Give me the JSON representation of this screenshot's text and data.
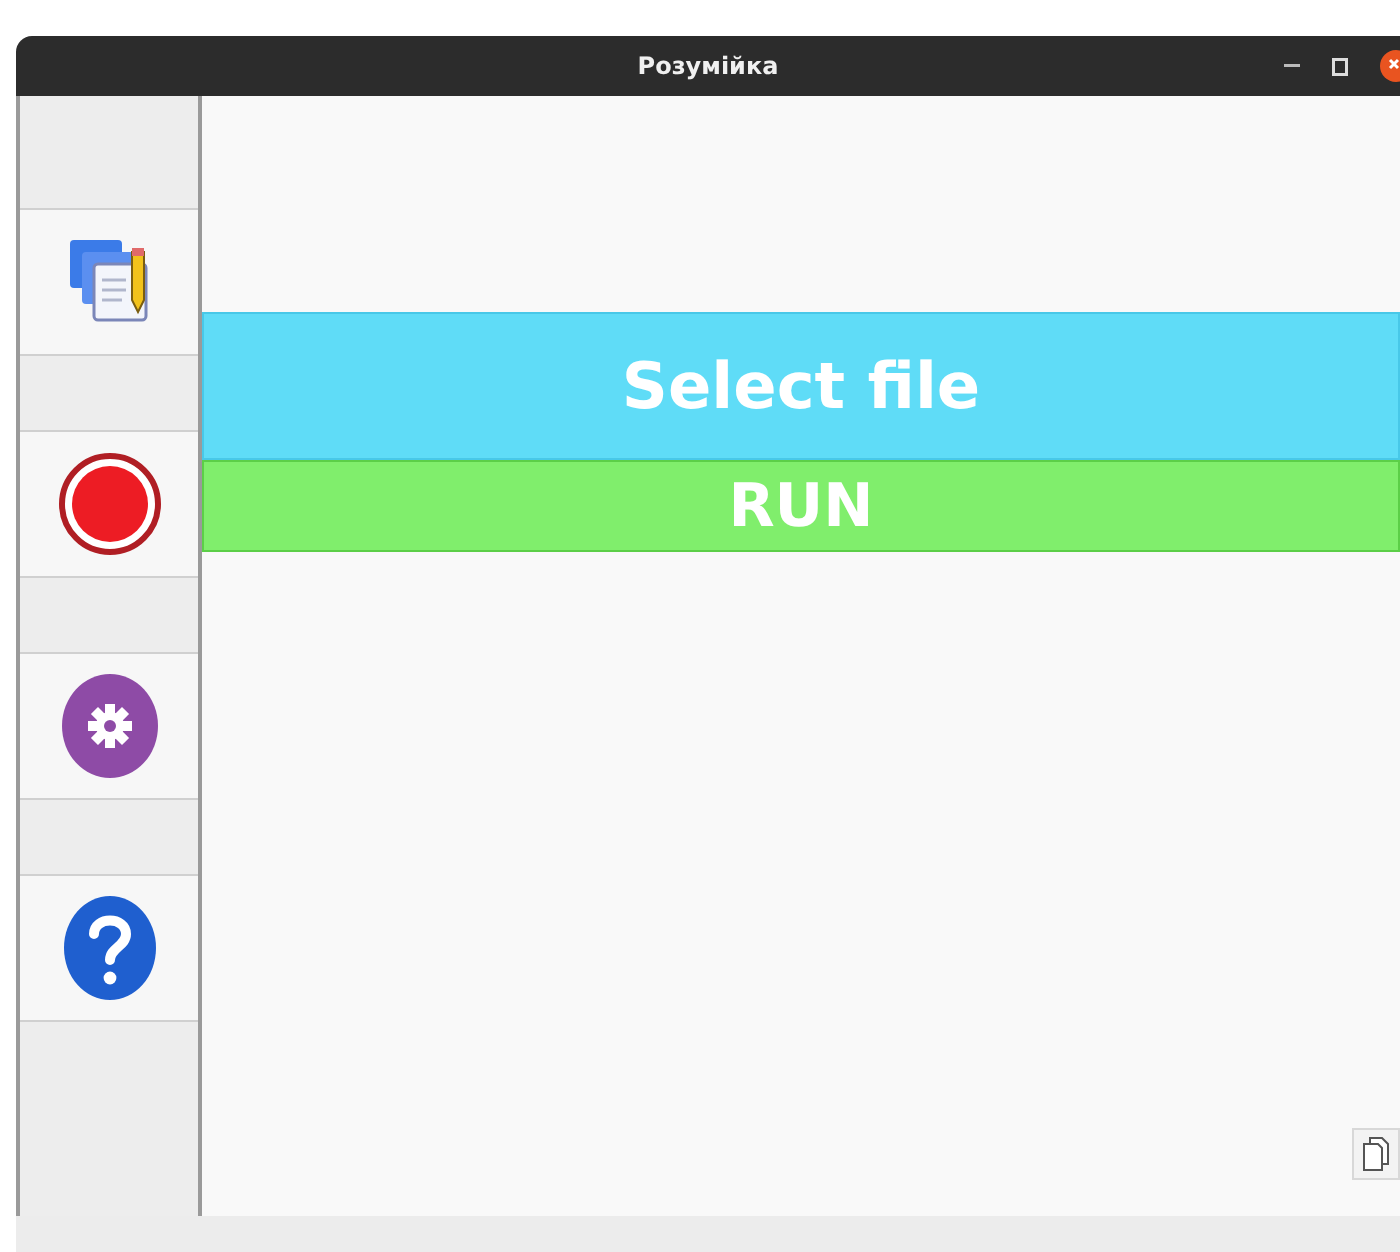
{
  "window": {
    "title": "Розумійка"
  },
  "sidebar": {
    "buttons": [
      {
        "kind": "edit"
      },
      {
        "kind": "record"
      },
      {
        "kind": "settings"
      },
      {
        "kind": "help"
      }
    ]
  },
  "actions": [
    {
      "kind": "select",
      "label": "Select file"
    },
    {
      "kind": "run",
      "label": "RUN"
    }
  ]
}
